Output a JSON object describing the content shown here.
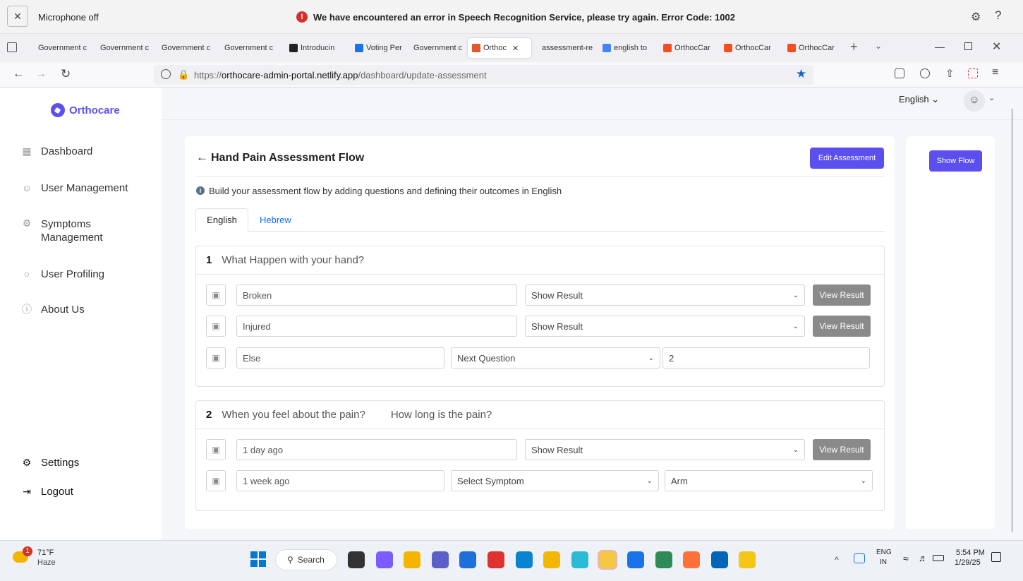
{
  "notification": {
    "mic_label": "Microphone off",
    "error_text": "We have encountered an error in Speech Recognition Service, please try again. Error Code: 1002"
  },
  "tabs": [
    {
      "label": "Government c",
      "color": "#999"
    },
    {
      "label": "Government c",
      "color": "#999"
    },
    {
      "label": "Government c",
      "color": "#999"
    },
    {
      "label": "Government c",
      "color": "#999"
    },
    {
      "label": "Introducin",
      "color": "#222"
    },
    {
      "label": "Voting Per",
      "color": "#1a73e8"
    },
    {
      "label": "Government c",
      "color": "#999"
    },
    {
      "label": "Orthoc",
      "color": "#e4572e",
      "active": true
    },
    {
      "label": "assessment-re",
      "color": "#999"
    },
    {
      "label": "english to",
      "color": "#4285f4"
    },
    {
      "label": "OrthocCar",
      "color": "#f24e1e"
    },
    {
      "label": "OrthocCar",
      "color": "#f24e1e"
    },
    {
      "label": "OrthocCar",
      "color": "#f24e1e"
    }
  ],
  "url": {
    "prefix": "https://",
    "host": "orthocare-admin-portal.netlify.app",
    "path": "/dashboard/update-assessment"
  },
  "brand": {
    "name": "Orthocare",
    "color": "#5b4ff0"
  },
  "sidebar": {
    "items": [
      {
        "label": "Dashboard",
        "icon": "grid-icon"
      },
      {
        "label": "User Management",
        "icon": "users-icon"
      },
      {
        "label": "Symptoms Management",
        "icon": "gear-outline-icon"
      },
      {
        "label": "User Profiling",
        "icon": "profile-icon"
      },
      {
        "label": "About Us",
        "icon": "help-icon"
      }
    ],
    "settings": "Settings",
    "logout": "Logout"
  },
  "header": {
    "language": "English"
  },
  "page": {
    "title": "Hand Pain Assessment Flow",
    "edit_button": "Edit Assessment",
    "show_flow_button": "Show Flow",
    "info": "Build your assessment flow by adding questions and defining their outcomes in English",
    "tabs": [
      "English",
      "Hebrew"
    ]
  },
  "questions": [
    {
      "number": "1",
      "text": "What Happen with your hand?",
      "answers": [
        {
          "text": "Broken",
          "action": "Show Result",
          "button": "View Result"
        },
        {
          "text": "Injured",
          "action": "Show Result",
          "button": "View Result"
        },
        {
          "text": "Else",
          "action": "Next Question",
          "value": "2"
        }
      ]
    },
    {
      "number": "2",
      "text": "When you feel about the pain?",
      "alt_text": "How long is the pain?",
      "answers": [
        {
          "text": "1 day ago",
          "action": "Show Result",
          "button": "View Result"
        },
        {
          "text": "1 week ago",
          "action": "Select Symptom",
          "value": "Arm"
        }
      ]
    }
  ],
  "taskbar": {
    "weather_temp": "71°F",
    "weather_desc": "Haze",
    "weather_badge": "1",
    "search": "Search",
    "lang_top": "ENG",
    "lang_bottom": "IN",
    "time": "5:54 PM",
    "date": "1/29/25"
  }
}
